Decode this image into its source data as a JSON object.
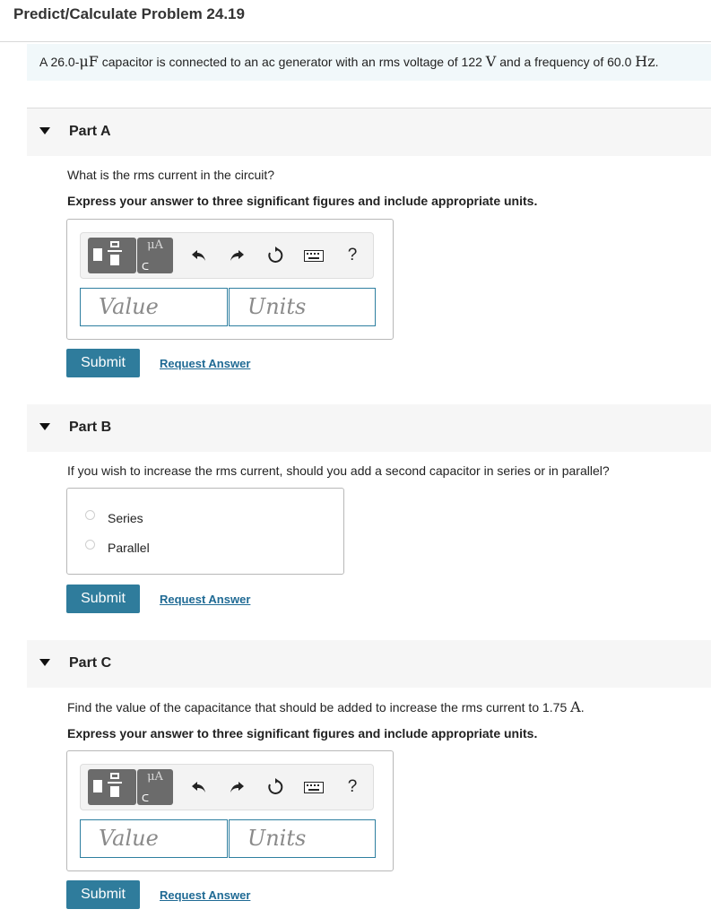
{
  "title": "Predict/Calculate Problem 24.19",
  "problem": {
    "text_a": "A 26.0-",
    "unit_mu_f": "μF",
    "text_b": " capacitor is connected to an ac generator with an rms voltage of 122 ",
    "unit_v": "V",
    "text_c": " and a frequency of 60.0 ",
    "unit_hz": "Hz",
    "text_d": "."
  },
  "toolbar": {
    "mu_label": "μA",
    "help_label": "?"
  },
  "inputs": {
    "value_placeholder": "Value",
    "units_placeholder": "Units"
  },
  "buttons": {
    "submit": "Submit",
    "request_answer": "Request Answer"
  },
  "part_a": {
    "label": "Part A",
    "question": "What is the rms current in the circuit?",
    "instruction": "Express your answer to three significant figures and include appropriate units."
  },
  "part_b": {
    "label": "Part B",
    "question": "If you wish to increase the rms current, should you add a second capacitor in series or in parallel?",
    "options": [
      "Series",
      "Parallel"
    ]
  },
  "part_c": {
    "label": "Part C",
    "question_a": "Find the value of the capacitance that should be added to increase the rms current to 1.75 ",
    "unit_a": "A",
    "question_b": ".",
    "instruction": "Express your answer to three significant figures and include appropriate units."
  }
}
